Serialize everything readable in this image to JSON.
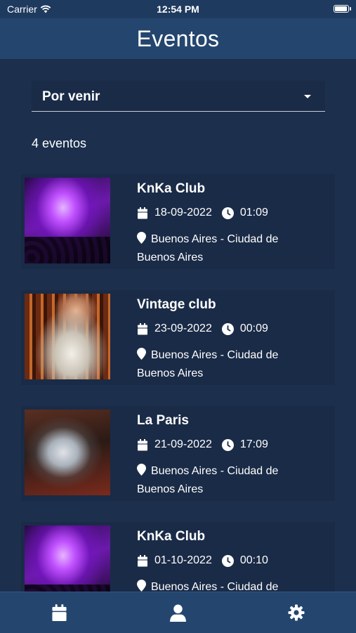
{
  "status_bar": {
    "carrier": "Carrier",
    "time": "12:54 PM",
    "wifi_icon": "wifi-icon",
    "battery_icon": "battery-icon"
  },
  "header": {
    "title": "Eventos"
  },
  "filter": {
    "selected": "Por venir",
    "caret_icon": "chevron-down-icon"
  },
  "count_label": "4 eventos",
  "events": [
    {
      "name": "KnKa Club",
      "date": "18-09-2022",
      "time": "01:09",
      "location": "Buenos Aires - Ciudad de Buenos Aires",
      "image": "club-lights-photo"
    },
    {
      "name": "Vintage club",
      "date": "23-09-2022",
      "time": "00:09",
      "location": "Buenos Aires - Ciudad de Buenos Aires",
      "image": "bartender-photo"
    },
    {
      "name": "La Paris",
      "date": "21-09-2022",
      "time": "17:09",
      "location": "Buenos Aires - Ciudad de Buenos Aires",
      "image": "smoke-drink-photo"
    },
    {
      "name": "KnKa Club",
      "date": "01-10-2022",
      "time": "00:10",
      "location": "Buenos Aires - Ciudad de Buenos Aires",
      "image": "club-lights-photo"
    }
  ],
  "tab_bar": {
    "items": [
      {
        "icon": "calendar-icon"
      },
      {
        "icon": "user-icon"
      },
      {
        "icon": "gear-icon"
      }
    ]
  },
  "colors": {
    "background": "#1c2f4d",
    "header": "#24466e",
    "card": "#1a2b47",
    "text": "#ffffff"
  }
}
